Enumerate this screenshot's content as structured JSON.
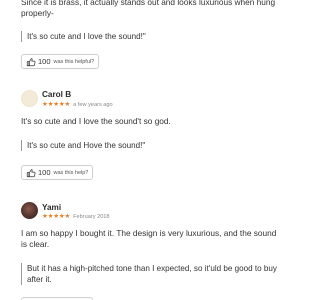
{
  "reviews": [
    {
      "body_tail": "Since it is brass, it actually stands out and looks luxurious when hung properly-",
      "quote": "It's so cute and I love the sound!\"",
      "helpful": {
        "count": "100",
        "label": "was this helpful?"
      }
    },
    {
      "name": "Carol B",
      "stars": "★★★★★",
      "date": "a few years ago",
      "body": "It's so cute and I love the sound't so god.",
      "quote": "It's so cute and Hove the sound!\"",
      "helpful": {
        "count": "100",
        "label": "was this help?"
      }
    },
    {
      "name": "Yami",
      "stars": "★★★★★",
      "date": "February 2018",
      "body": "I am so happy I bought it. The design is very luxurious, and the sound is clear.",
      "quote": "But it has a high-pitched tone than I expected, so it'uld be good to buy after it."
    }
  ],
  "colors": {
    "star": "#e0822a",
    "quote_bar": "#9a9a9a",
    "border": "#cfcfcf"
  },
  "icons": {
    "helpful": "thumbs-up-icon"
  }
}
